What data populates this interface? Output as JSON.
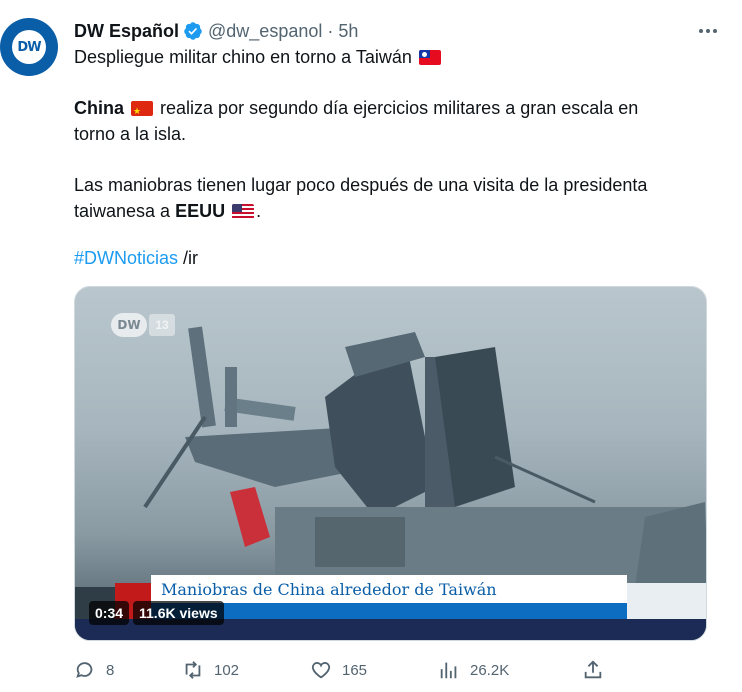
{
  "author": {
    "display_name": "DW Español",
    "handle": "@dw_espanol",
    "separator": "·",
    "time": "5h",
    "avatar_text": "DW"
  },
  "tweet": {
    "line1": "Despliegue militar chino en torno a Taiwán",
    "p2_bold": "China",
    "p2_line1_rest": " realiza por segundo día ejercicios militares a gran escala en",
    "p2_line2": "torno a la isla.",
    "p3_line1": "Las maniobras tienen lugar poco después de una visita de la presidenta",
    "p3_line2_start": "taiwanesa a ",
    "p3_line2_bold": "EEUU",
    "p3_line2_end": ".",
    "hashtag": "#DWNoticias",
    "suffix": " /ir"
  },
  "media": {
    "watermark_logo": "DW",
    "watermark_num": "13",
    "lower_third": "Maniobras de China alrededor de Taiwán",
    "duration": "0:34",
    "views": "11.6K views"
  },
  "actions": {
    "replies": "8",
    "retweets": "102",
    "likes": "165",
    "views": "26.2K"
  },
  "icons": {
    "verified": "verified-badge-icon",
    "more": "more-icon",
    "reply": "reply-icon",
    "retweet": "retweet-icon",
    "like": "heart-icon",
    "views": "views-icon",
    "share": "share-icon"
  },
  "colors": {
    "link": "#1d9bf0",
    "muted": "#536471",
    "avatar_bg": "#0a5ea8"
  }
}
